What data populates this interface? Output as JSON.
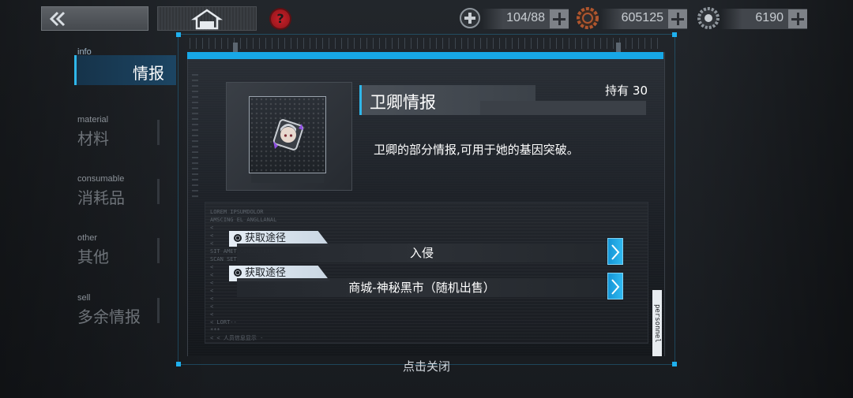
{
  "topbar": {
    "back_icon": "double-chevron-left-icon",
    "home_icon": "home-icon",
    "help_icon": "question-icon",
    "help_glyph": "?",
    "resources": [
      {
        "icon": "medkit-plus-icon",
        "value": "104/88",
        "color": "#9aa1a8"
      },
      {
        "icon": "gear-coin-icon",
        "value": "605125",
        "color": "#b0562e"
      },
      {
        "icon": "crystal-gear-icon",
        "value": "6190",
        "color": "#9aa1a8"
      }
    ]
  },
  "sidebar": {
    "tabs": [
      {
        "en": "info",
        "zh": "情报",
        "active": true
      },
      {
        "en": "material",
        "zh": "材料",
        "active": false
      },
      {
        "en": "consumable",
        "zh": "消耗品",
        "active": false
      },
      {
        "en": "other",
        "zh": "其他",
        "active": false
      },
      {
        "en": "sell",
        "zh": "多余情报",
        "active": false
      }
    ]
  },
  "dialog": {
    "item_title": "卫卿情报",
    "owned": "持有 30",
    "description": "卫卿的部分情报,可用于她的基因突破。",
    "item_icon": "character-portrait-icon",
    "sources": [
      {
        "label": "获取途径",
        "value": "入侵"
      },
      {
        "label": "获取途径",
        "value": "商城-神秘黑市（随机出售）"
      }
    ],
    "side_tag": "personnel",
    "deco_text": "LOREM IPSUMDOLOR\nAMSCING EL ANGLLANAL\n<\n<\n<\nSIT AMET.CONSECTETUR\nSCAN SETS...\n<\n<\n<\n<\n<\n<\n<\n< LORT--\n***\n< < 人员信息显示 -"
  },
  "close_hint": "点击关闭",
  "colors": {
    "accent": "#17a7e6",
    "panel": "#1c2026"
  }
}
